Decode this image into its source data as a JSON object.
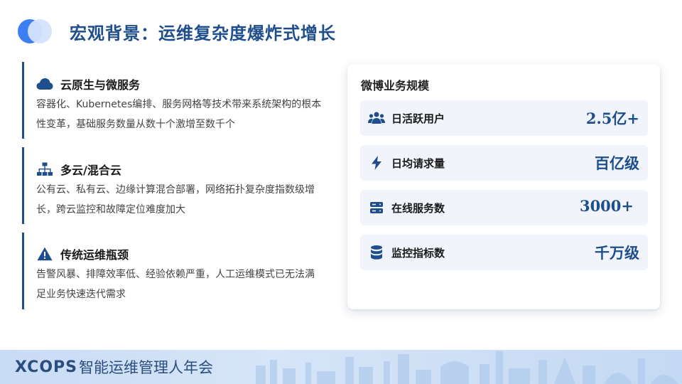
{
  "header": {
    "title": "宏观背景：运维复杂度爆炸式增长"
  },
  "sections": [
    {
      "icon": "cloud-icon",
      "title": "云原生与微服务",
      "desc": "容器化、Kubernetes编排、服务网格等技术带来系统架构的根本性变革，基础服务数量从数十个激增至数千个"
    },
    {
      "icon": "network-icon",
      "title": "多云/混合云",
      "desc": "公有云、私有云、边缘计算混合部署，网络拓扑复杂度指数级增长，跨云监控和故障定位难度加大"
    },
    {
      "icon": "warning-icon",
      "title": "传统运维瓶颈",
      "desc": "告警风暴、排障效率低、经验依赖严重，人工运维模式已无法满足业务快速迭代需求"
    }
  ],
  "card": {
    "title": "微博业务规模",
    "metrics": [
      {
        "icon": "users-icon",
        "label": "日活跃用户",
        "value": "2.5亿+"
      },
      {
        "icon": "bolt-icon",
        "label": "日均请求量",
        "value": "百亿级"
      },
      {
        "icon": "server-icon",
        "label": "在线服务数",
        "value": "3000+"
      },
      {
        "icon": "database-icon",
        "label": "监控指标数",
        "value": "千万级"
      }
    ]
  },
  "footer": {
    "brand": "XCOPS",
    "subtitle": "智能运维管理人年会"
  },
  "colors": {
    "primary": "#1f4e8c",
    "accent": "#3b7ff2",
    "metric_bg": "#f1f5fb"
  }
}
